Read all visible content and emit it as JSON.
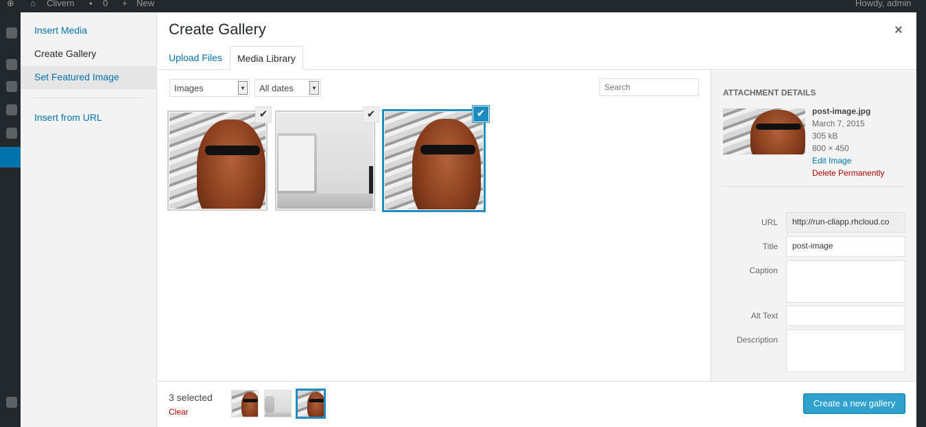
{
  "adminbar": {
    "site": "Clivern",
    "comments": "0",
    "new": "New",
    "howdy": "Howdy, admin"
  },
  "menu": {
    "items": [
      {
        "label": "Insert Media"
      },
      {
        "label": "Create Gallery"
      },
      {
        "label": "Set Featured Image"
      },
      {
        "label": "Insert from URL"
      }
    ]
  },
  "frame": {
    "title": "Create Gallery",
    "close": "×"
  },
  "tabs": [
    {
      "label": "Upload Files"
    },
    {
      "label": "Media Library"
    }
  ],
  "filters": {
    "type": "Images",
    "date": "All dates",
    "search_placeholder": "Search"
  },
  "attachments": [
    {
      "name": "post-image.jpg",
      "kind": "photo",
      "checked": true,
      "focused": false
    },
    {
      "name": "laptop",
      "kind": "photo",
      "checked": true,
      "focused": false
    },
    {
      "name": "post-image.jpg",
      "kind": "photo",
      "checked": true,
      "focused": true
    }
  ],
  "check_glyph": "✔",
  "details": {
    "heading": "Attachment Details",
    "filename": "post-image.jpg",
    "date": "March 7, 2015",
    "size": "305 kB",
    "dimensions": "800 × 450",
    "edit": "Edit Image",
    "delete": "Delete Permanently",
    "fields": {
      "url_label": "URL",
      "url_value": "http://run-cliapp.rhcloud.co",
      "title_label": "Title",
      "title_value": "post-image",
      "caption_label": "Caption",
      "caption_value": "",
      "alt_label": "Alt Text",
      "alt_value": "",
      "description_label": "Description",
      "description_value": ""
    }
  },
  "toolbar": {
    "selected": "3 selected",
    "clear": "Clear",
    "primary": "Create a new gallery"
  },
  "colors": {
    "accent": "#0073aa",
    "selected_border": "#1e8cbe",
    "primary_button": "#2ea2cc",
    "danger": "#aa0000"
  }
}
